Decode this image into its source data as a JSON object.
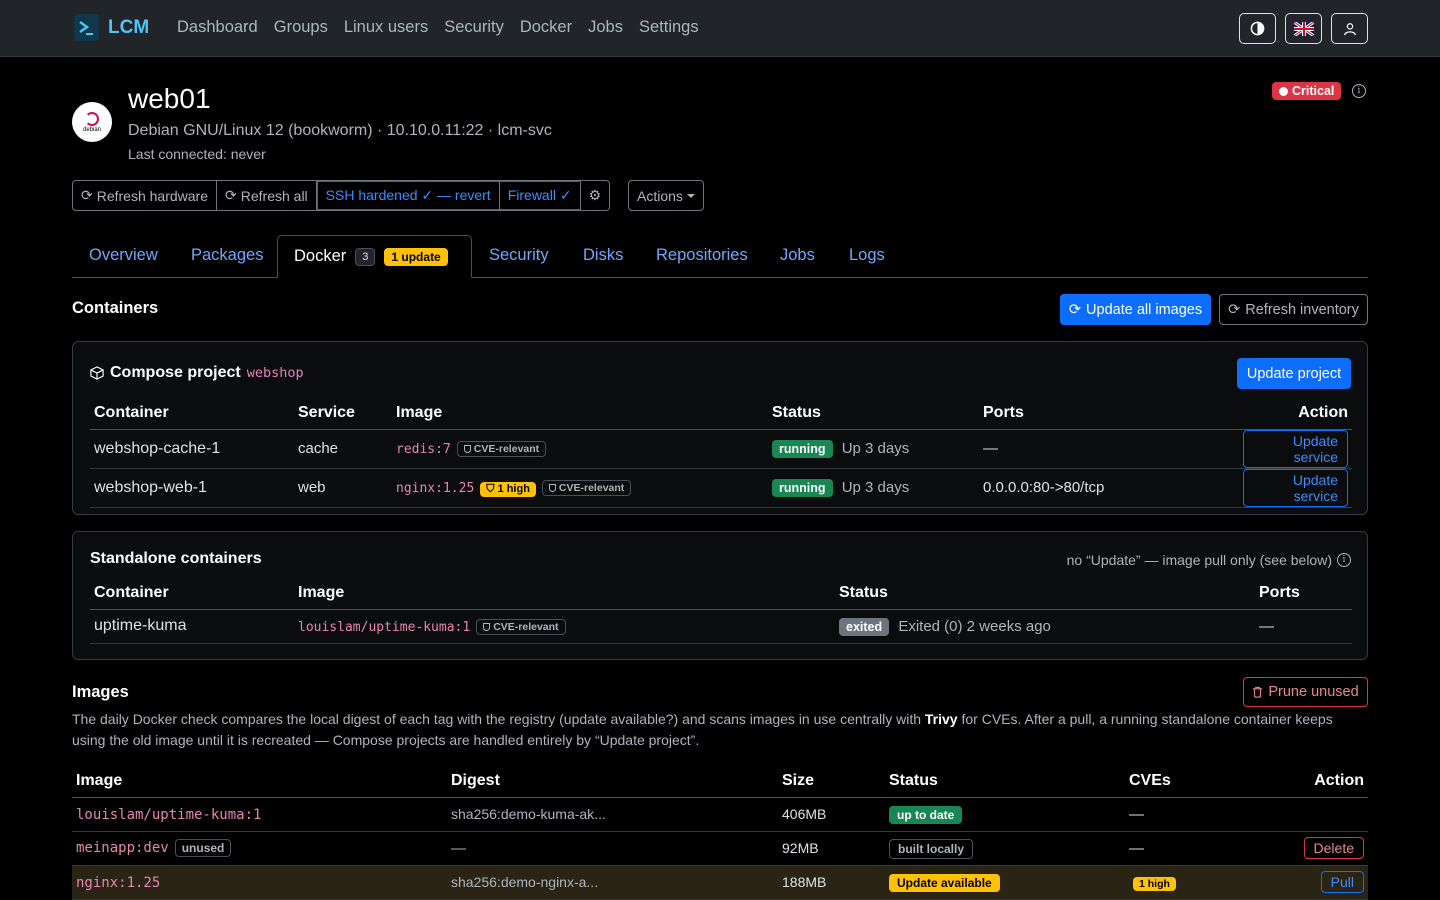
{
  "nav": {
    "brand": "LCM",
    "links": [
      "Dashboard",
      "Groups",
      "Linux users",
      "Security",
      "Docker",
      "Jobs",
      "Settings"
    ]
  },
  "host": {
    "name": "web01",
    "os_logo_text": "debian",
    "subtitle": "Debian GNU/Linux 12 (bookworm) · 10.10.0.11:22 · lcm-svc",
    "last_connected": "Last connected: never",
    "severity": "Critical"
  },
  "actions": {
    "refresh_hardware": "Refresh hardware",
    "refresh_all": "Refresh all",
    "ssh_hardened": "SSH hardened ✓ — revert",
    "firewall": "Firewall ✓",
    "actions": "Actions"
  },
  "tabs": {
    "overview": "Overview",
    "packages": "Packages",
    "docker": "Docker",
    "docker_count": "3",
    "docker_update": "1 update",
    "security": "Security",
    "disks": "Disks",
    "repositories": "Repositories",
    "jobs": "Jobs",
    "logs": "Logs"
  },
  "containers": {
    "title": "Containers",
    "update_all": "Update all images",
    "refresh_inventory": "Refresh inventory"
  },
  "compose": {
    "label": "Compose project",
    "project": "webshop",
    "update_project": "Update project",
    "headers": [
      "Container",
      "Service",
      "Image",
      "Status",
      "Ports",
      "Action"
    ],
    "rows": [
      {
        "container": "webshop-cache-1",
        "service": "cache",
        "image": "redis:7",
        "high": "",
        "cve": "CVE-relevant",
        "status": "running",
        "uptime": "Up 3 days",
        "ports": "—",
        "action": "Update service"
      },
      {
        "container": "webshop-web-1",
        "service": "web",
        "image": "nginx:1.25",
        "high": "1 high",
        "cve": "CVE-relevant",
        "status": "running",
        "uptime": "Up 3 days",
        "ports": "0.0.0.0:80->80/tcp",
        "action": "Update service"
      }
    ]
  },
  "standalone": {
    "title": "Standalone containers",
    "note": "no “Update” — image pull only (see below)",
    "headers": [
      "Container",
      "Image",
      "Status",
      "Ports"
    ],
    "rows": [
      {
        "container": "uptime-kuma",
        "image": "louislam/uptime-kuma:1",
        "cve": "CVE-relevant",
        "status": "exited",
        "detail": "Exited (0) 2 weeks ago",
        "ports": "—"
      }
    ]
  },
  "images": {
    "title": "Images",
    "prune": "Prune unused",
    "desc_before": "The daily Docker check compares the local digest of each tag with the registry (update available?) and scans images in use centrally with ",
    "desc_bold": "Trivy",
    "desc_after": " for CVEs. After a pull, a running standalone container keeps using the old image until it is recreated — Compose projects are handled entirely by “Update project”.",
    "headers": [
      "Image",
      "Digest",
      "Size",
      "Status",
      "CVEs",
      "Action"
    ],
    "rows": [
      {
        "image": "louislam/uptime-kuma:1",
        "tag": "",
        "digest": "sha256:demo-kuma-ak...",
        "size": "406MB",
        "status": "up to date",
        "cves": "—",
        "action": ""
      },
      {
        "image": "meinapp:dev",
        "tag": "unused",
        "digest": "—",
        "size": "92MB",
        "status": "built locally",
        "cves": "—",
        "action": "Delete"
      },
      {
        "image": "nginx:1.25",
        "tag": "",
        "digest": "sha256:demo-nginx-a...",
        "size": "188MB",
        "status": "Update available",
        "cves": "1 high",
        "action": "Pull"
      }
    ]
  }
}
